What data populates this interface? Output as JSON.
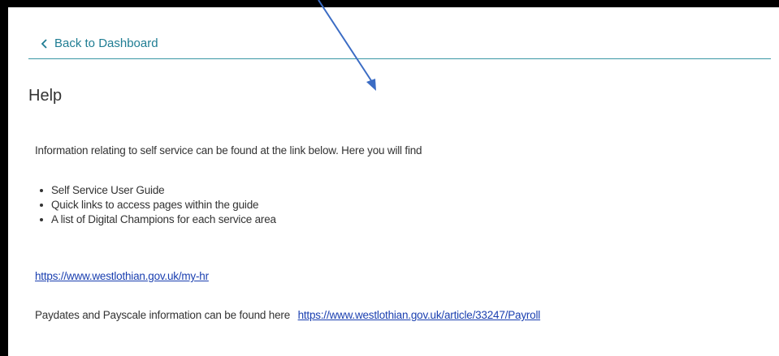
{
  "nav": {
    "back_label": "Back to Dashboard"
  },
  "page": {
    "title": "Help",
    "intro": "Information relating to self service can be found at the link below. Here you will find",
    "bullets": [
      "Self Service User Guide",
      "Quick links to access pages within the guide",
      "A list of Digital Champions for each service area"
    ],
    "myhr_link": "https://www.westlothian.gov.uk/my-hr",
    "paydates_text": "Paydates and Payscale information can be found here",
    "payroll_link": "https://www.westlothian.gov.uk/article/33247/Payroll"
  },
  "colors": {
    "accent": "#1f7d93",
    "link": "#1a3fb0",
    "arrow": "#3b6cc4",
    "frame": "#000000"
  },
  "icons": {
    "back": "chevron-left-icon",
    "annotation": "arrow-annotation"
  }
}
